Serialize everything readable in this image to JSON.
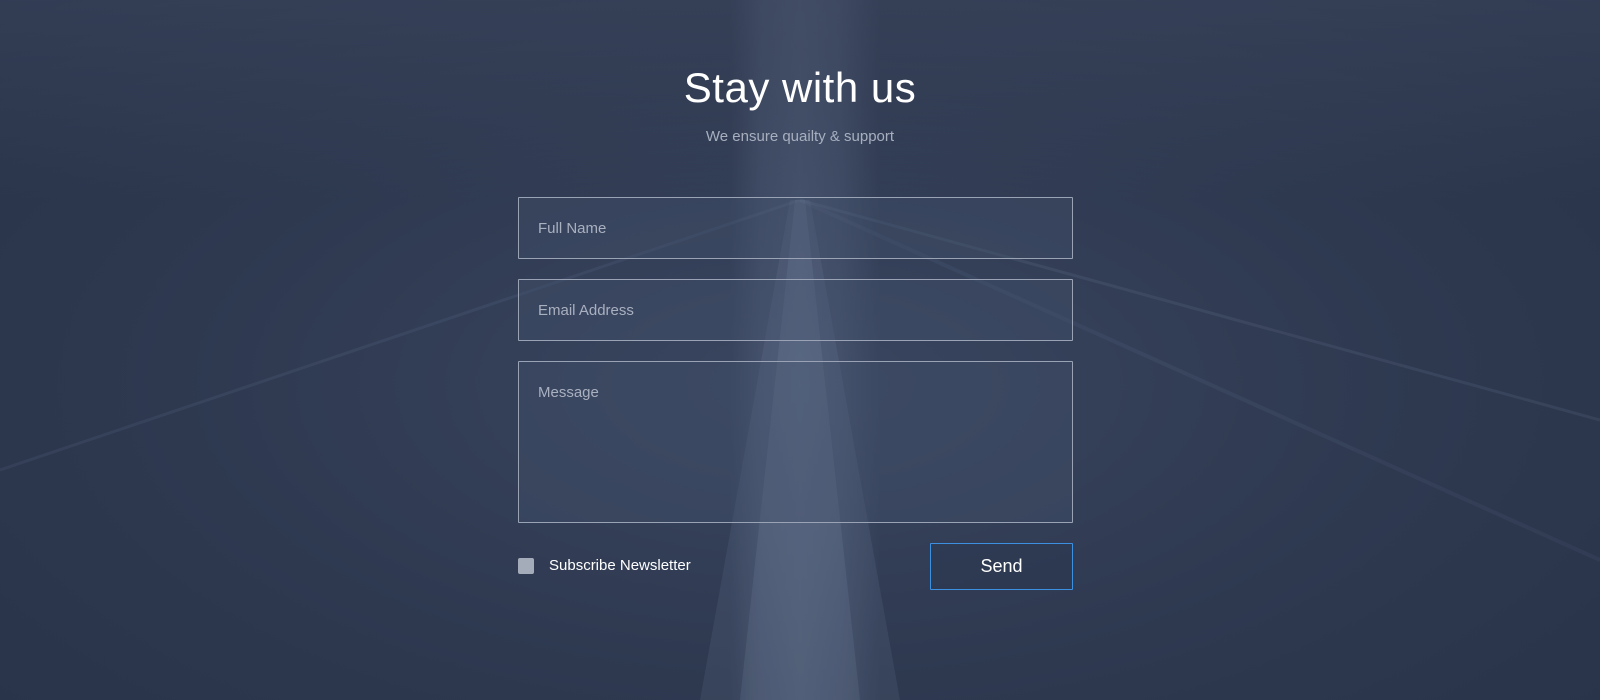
{
  "header": {
    "title": "Stay with us",
    "subtitle": "We ensure quailty & support"
  },
  "form": {
    "full_name": {
      "value": "",
      "placeholder": "Full Name"
    },
    "email": {
      "value": "",
      "placeholder": "Email Address"
    },
    "message": {
      "value": "",
      "placeholder": "Message"
    },
    "newsletter": {
      "label": "Subscribe Newsletter",
      "checked": false
    },
    "send_label": "Send"
  },
  "colors": {
    "background_overlay": "#2f3a52",
    "accent_border": "#3d8fe0",
    "subtitle_text": "#a7afbf",
    "field_border": "#9aa3b5",
    "checkbox_fill": "#a5acb9"
  }
}
